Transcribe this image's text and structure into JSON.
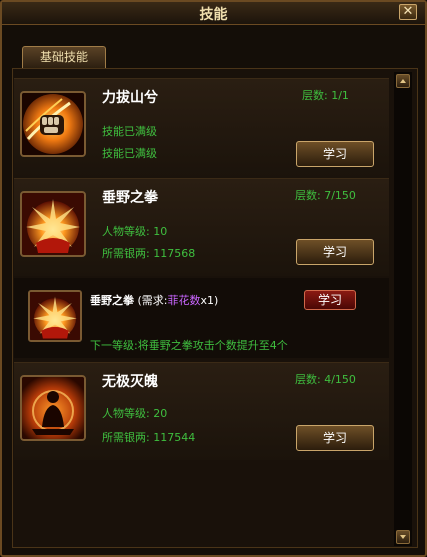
{
  "window": {
    "title": "技能",
    "close_label": "✕"
  },
  "tab": {
    "label": "基础技能"
  },
  "skills": [
    {
      "name": "力拔山兮",
      "tiers_label": "层数:",
      "tiers_value": "1/1",
      "line1": "技能已满级",
      "line2": "技能已满级",
      "button": "学习",
      "icon": "fist-icon"
    },
    {
      "name": "垂野之拳",
      "tiers_label": "层数:",
      "tiers_value": "7/150",
      "line1": "人物等级: 10",
      "line2": "所需银两: 117568",
      "button": "学习",
      "icon": "explosion-icon"
    },
    {
      "name": "无极灭魄",
      "tiers_label": "层数:",
      "tiers_value": "4/150",
      "line1": "人物等级: 20",
      "line2": "所需银两: 117544",
      "button": "学习",
      "icon": "silhouette-icon"
    }
  ],
  "sub": {
    "name": "垂野之拳",
    "req_open": "(需求:",
    "req_item": "菲花数",
    "req_close": "x1)",
    "button": "学习",
    "next": "下一等级:将垂野之拳攻击个数提升至4个",
    "icon": "explosion-icon"
  },
  "colors": {
    "accent_green": "#3fbf3f",
    "frame_gold": "#c9a56a",
    "req_purple": "#c966ff"
  }
}
